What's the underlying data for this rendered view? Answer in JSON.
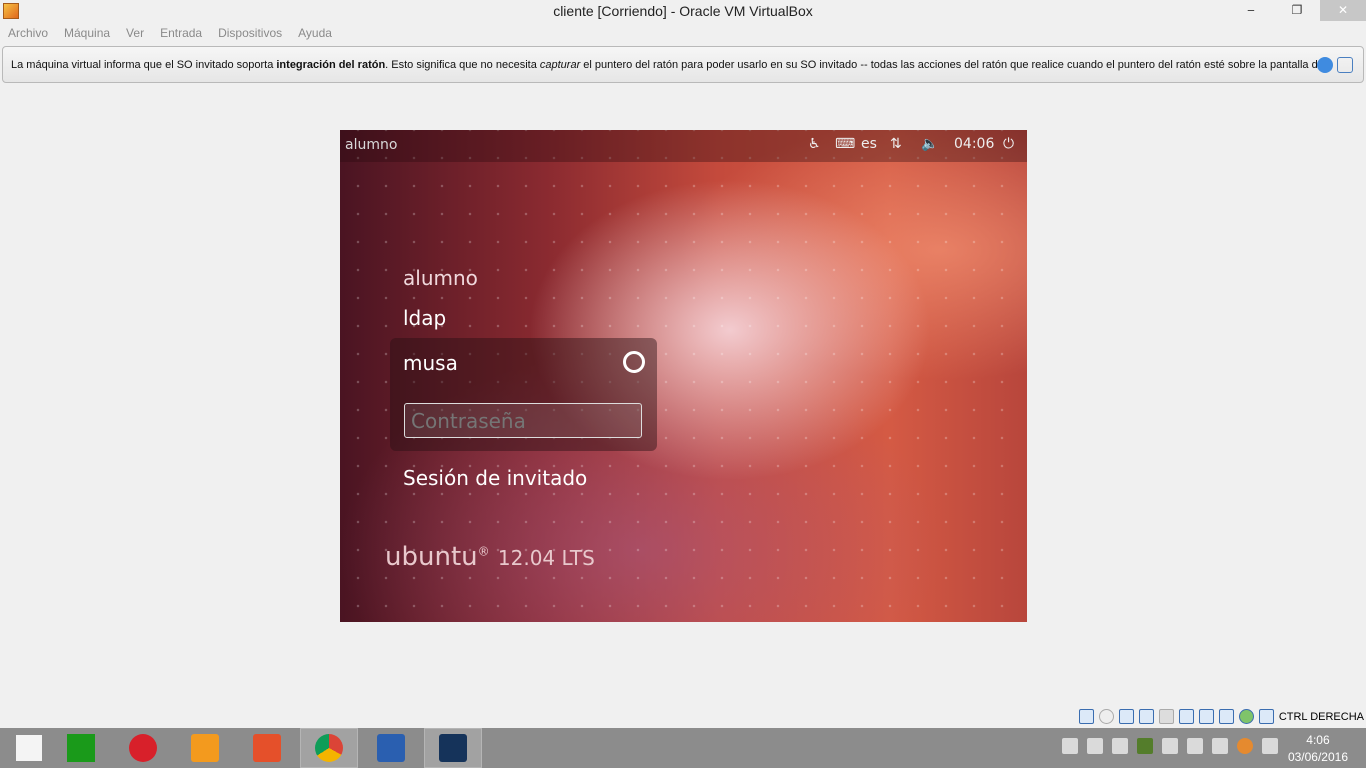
{
  "window": {
    "title": "cliente [Corriendo] - Oracle VM VirtualBox",
    "minimize": "‒",
    "restore": "❐",
    "close": "✕"
  },
  "menu": [
    "Archivo",
    "Máquina",
    "Ver",
    "Entrada",
    "Dispositivos",
    "Ayuda"
  ],
  "notice": {
    "part1": "La máquina virtual informa que el SO invitado soporta ",
    "bold": "integración del ratón",
    "part2": ". Esto significa que no necesita ",
    "italic": "capturar",
    "part3": " el puntero del ratón para poder usarlo en su SO invitado -- todas las acciones del ratón que realice cuando el puntero del ratón esté sobre la pantalla de"
  },
  "guest": {
    "hostname": "alumno",
    "keyboard": "es",
    "time": "04:06",
    "users": [
      "alumno",
      "ldap"
    ],
    "selected_user": "musa",
    "password_placeholder": "Contraseña",
    "guest_session": "Sesión de invitado",
    "brand": "ubuntu",
    "version": "12.04 LTS"
  },
  "statusbar": {
    "host_key": "CTRL DERECHA",
    "icons": [
      "hard-disk-icon",
      "optical-drive-icon",
      "network-icon",
      "usb-icon",
      "shared-folder-icon",
      "display-icon",
      "video-capture-icon",
      "cpu-icon",
      "mouse-integration-icon",
      "host-key-icon"
    ]
  },
  "taskbar": {
    "apps": [
      "start",
      "store",
      "opera",
      "media-player",
      "powerpoint",
      "chrome",
      "word",
      "virtualbox"
    ],
    "time": "4:06",
    "date": "03/06/2016"
  },
  "colors": {
    "ubuntu_accent": "#dd4814",
    "taskbar": "#8c8c8c"
  }
}
